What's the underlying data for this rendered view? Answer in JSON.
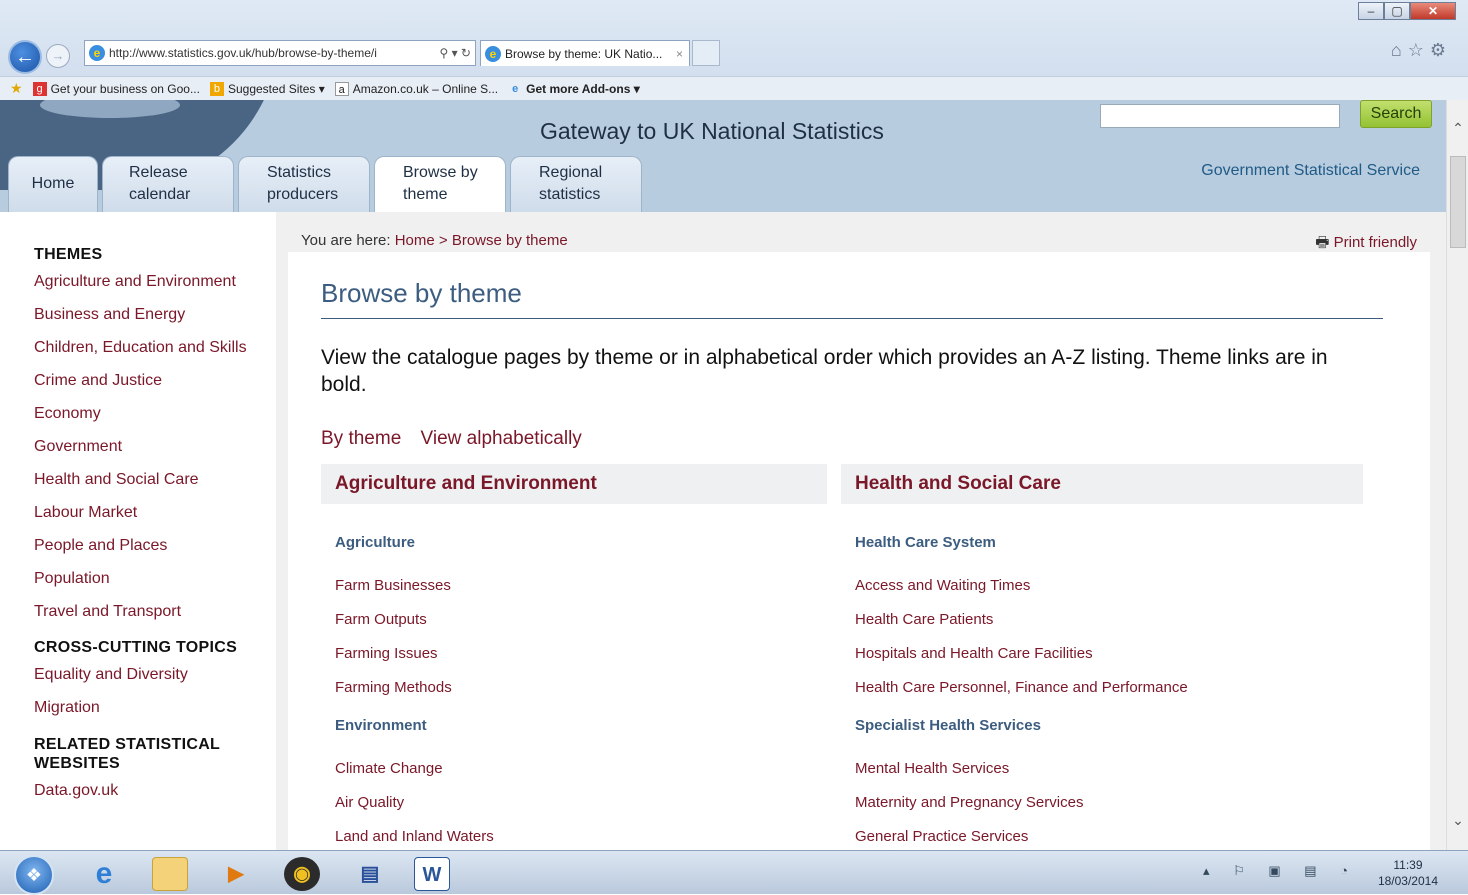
{
  "browser": {
    "url": "http://www.statistics.gov.uk/hub/browse-by-theme/i",
    "tab_title": "Browse by theme: UK Natio...",
    "tab_close": "×",
    "address_controls": "⚲ ▾ ↻",
    "window_controls": {
      "minimize": "–",
      "maximize": "▢",
      "close": "✕"
    },
    "right_icons": "⌂☆⚙",
    "favorites": [
      {
        "label": "Get your business on Goo...",
        "icon": "google-icon"
      },
      {
        "label": "Suggested Sites ▾",
        "icon": "bing-icon"
      },
      {
        "label": "Amazon.co.uk – Online S...",
        "icon": "amazon-icon"
      },
      {
        "label": "Get more Add-ons ▾",
        "icon": "ie-icon"
      }
    ]
  },
  "header": {
    "site_title": "Gateway to UK National Statistics",
    "search_button": "Search",
    "gss_link": "Government Statistical Service",
    "nav_tabs": [
      {
        "line1": "Home",
        "line2": ""
      },
      {
        "line1": "Release",
        "line2": "calendar"
      },
      {
        "line1": "Statistics",
        "line2": "producers"
      },
      {
        "line1": "Browse by",
        "line2": "theme"
      },
      {
        "line1": "Regional",
        "line2": "statistics"
      }
    ]
  },
  "sidebar": {
    "themes_heading": "THEMES",
    "themes": [
      "Agriculture and Environment",
      "Business and Energy",
      "Children, Education and Skills",
      "Crime and Justice",
      "Economy",
      "Government",
      "Health and Social Care",
      "Labour Market",
      "People and Places",
      "Population",
      "Travel and Transport"
    ],
    "cross_heading": "CROSS-CUTTING TOPICS",
    "cross_topics": [
      "Equality and Diversity",
      "Migration"
    ],
    "related_heading_1": "RELATED STATISTICAL",
    "related_heading_2": "WEBSITES",
    "related": [
      "Data.gov.uk"
    ]
  },
  "main": {
    "breadcrumb_prefix": "You are here: ",
    "breadcrumb_home": "Home",
    "breadcrumb_sep": " > ",
    "breadcrumb_current": "Browse by theme",
    "print_friendly": "Print friendly",
    "page_title": "Browse by theme",
    "intro": "View the catalogue pages by theme or in alphabetical order which provides an A-Z listing. Theme links are in bold.",
    "view_by_theme": "By theme",
    "view_alpha": "View alphabetically",
    "left_theme": {
      "heading": "Agriculture and Environment",
      "sub1": "Agriculture",
      "sub1_topics": [
        "Farm Businesses",
        "Farm Outputs",
        "Farming Issues",
        "Farming Methods"
      ],
      "sub2": "Environment",
      "sub2_topics": [
        "Climate Change",
        "Air Quality",
        "Land and Inland Waters"
      ]
    },
    "right_theme": {
      "heading": "Health and Social Care",
      "sub1": "Health Care System",
      "sub1_topics": [
        "Access and Waiting Times",
        "Health Care Patients",
        "Hospitals and Health Care Facilities",
        "Health Care Personnel, Finance and Performance"
      ],
      "sub2": "Specialist Health Services",
      "sub2_topics": [
        "Mental Health Services",
        "Maternity and Pregnancy Services",
        "General Practice Services"
      ]
    }
  },
  "taskbar": {
    "tray_icons": "▴ ⚐ ▣ ▤ ◔",
    "time": "11:39",
    "date": "18/03/2014"
  }
}
